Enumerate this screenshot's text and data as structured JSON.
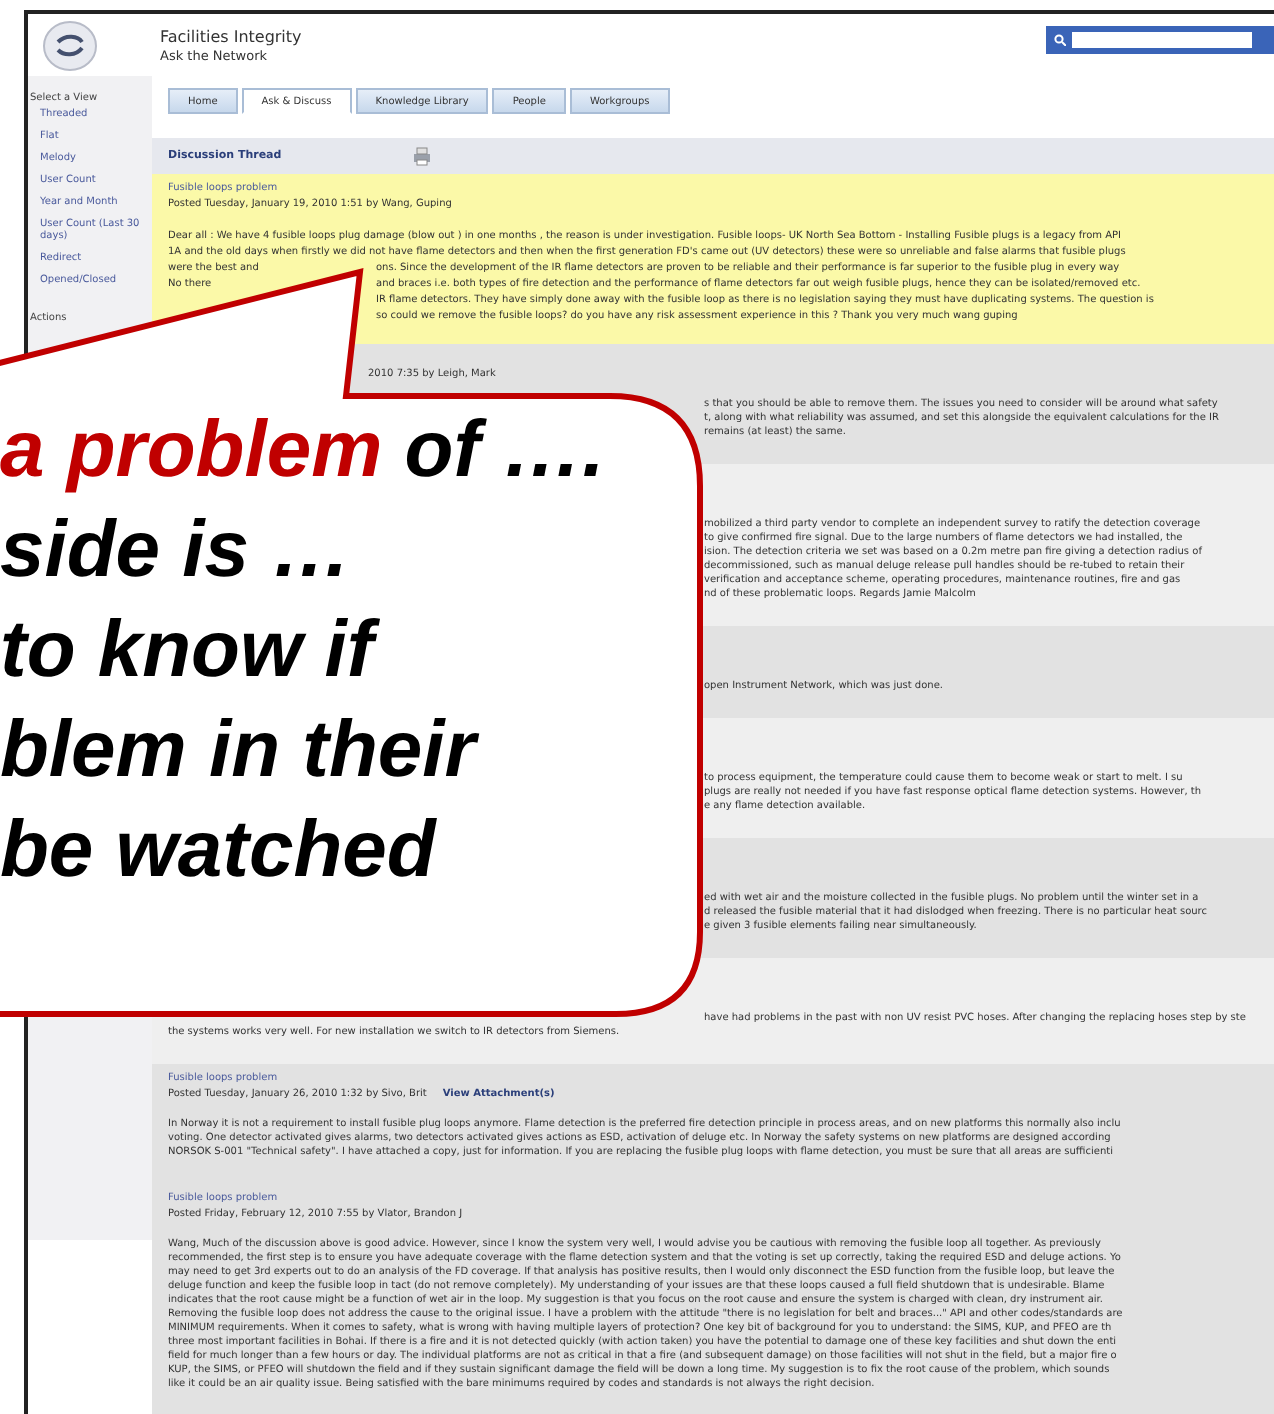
{
  "header": {
    "title": "Facilities Integrity",
    "subtitle": "Ask the Network"
  },
  "sidebar": {
    "heading": "Select a View",
    "items": [
      {
        "label": "Threaded"
      },
      {
        "label": "Flat"
      },
      {
        "label": "Melody"
      },
      {
        "label": "User Count"
      },
      {
        "label": "Year and Month"
      },
      {
        "label": "User Count (Last 30 days)"
      },
      {
        "label": "Redirect"
      },
      {
        "label": "Opened/Closed"
      }
    ],
    "actions": "Actions"
  },
  "tabs": [
    {
      "label": "Home",
      "selected": false
    },
    {
      "label": "Ask & Discuss",
      "selected": true
    },
    {
      "label": "Knowledge Library",
      "selected": false
    },
    {
      "label": "People",
      "selected": false
    },
    {
      "label": "Workgroups",
      "selected": false
    }
  ],
  "thread_title": "Discussion Thread",
  "posts": [
    {
      "kind": "highlight",
      "title": "Fusible loops problem",
      "posted": "Posted Tuesday, January 19, 2010 1:51 by Wang, Guping",
      "lines": [
        {
          "kind": "clear",
          "segments": [
            "Dear all : We have 4 fusible loops plug damage (blow out ) in one months , the reason is under investigation. Fusible loops- UK North Sea Bottom - Installing Fusible plugs is a legacy from API"
          ]
        },
        {
          "kind": "clear",
          "segments": [
            "1A and the old days when firstly we did not have flame detectors and then when the first generation FD's came out (UV detectors) these were so unreliable and false alarms that fusible plugs"
          ]
        },
        {
          "kind": "split",
          "segments": [
            "were the best and",
            "ons. Since the development of the IR flame detectors are proven to be reliable and their performance is far superior to the fusible plug in every way"
          ]
        },
        {
          "kind": "split",
          "segments": [
            "No there",
            "and braces i.e. both types of fire detection and the performance of flame detectors far out weigh fusible plugs, hence they can be isolated/removed etc."
          ]
        },
        {
          "kind": "tail",
          "segments": [
            "IR flame detectors. They have simply done away with the fusible loop as there is no legislation saying they must have duplicating systems. The question is"
          ]
        },
        {
          "kind": "tail",
          "segments": [
            "so could we remove the fusible loops? do you have any risk assessment experience in this ? Thank you very much wang guping"
          ]
        }
      ]
    },
    {
      "kind": "covered",
      "posted": "2010 7:35 by Leigh, Mark",
      "lines": [
        {
          "kind": "callout",
          "segments": [
            "s that you should be able to remove them. The issues you need to consider will be around what safety"
          ]
        },
        {
          "kind": "callout",
          "segments": [
            "t, along with what reliability was assumed, and set this alongside the equivalent calculations for the IR"
          ]
        },
        {
          "kind": "callout",
          "segments": [
            "remains (at least) the same."
          ]
        }
      ]
    },
    {
      "kind": "covered",
      "lines": [
        {
          "kind": "callout",
          "segments": [
            "mobilized a third party vendor to complete an independent survey to ratify the detection coverage"
          ]
        },
        {
          "kind": "callout",
          "segments": [
            "to give confirmed fire signal. Due to the large numbers of flame detectors we had installed, the"
          ]
        },
        {
          "kind": "callout",
          "segments": [
            "ision. The detection criteria we set was based on a 0.2m metre pan fire giving a detection radius of"
          ]
        },
        {
          "kind": "callout",
          "segments": [
            "decommissioned, such as manual deluge release pull handles should be re-tubed to retain their"
          ]
        },
        {
          "kind": "callout",
          "segments": [
            "verification and acceptance scheme, operating procedures, maintenance routines, fire and gas"
          ]
        },
        {
          "kind": "callout",
          "segments": [
            "nd of these problematic loops. Regards Jamie Malcolm"
          ]
        }
      ]
    },
    {
      "kind": "covered",
      "lines": [
        {
          "kind": "callout",
          "segments": [
            "open Instrument Network, which was just done."
          ]
        }
      ]
    },
    {
      "kind": "covered",
      "lines": [
        {
          "kind": "callout",
          "segments": [
            "to process equipment, the temperature could cause them to become weak or start to melt. I su"
          ]
        },
        {
          "kind": "callout",
          "segments": [
            "plugs are really not needed if you have fast response optical flame detection systems. However, th"
          ]
        },
        {
          "kind": "callout",
          "segments": [
            "e any flame detection available."
          ]
        }
      ]
    },
    {
      "kind": "covered",
      "lines": [
        {
          "kind": "callout",
          "segments": [
            "ed with wet air and the moisture collected in the fusible plugs. No problem until the winter set in a"
          ]
        },
        {
          "kind": "callout",
          "segments": [
            "d released the fusible material that it had dislodged when freezing. There is no particular heat sourc"
          ]
        },
        {
          "kind": "callout",
          "segments": [
            "e given 3 fusible elements failing near simultaneously."
          ]
        }
      ]
    },
    {
      "kind": "covered",
      "lines": [
        {
          "kind": "callout",
          "segments": [
            "have had problems in the past with non UV resist PVC hoses. After changing the replacing hoses step by ste"
          ]
        },
        {
          "kind": "clear",
          "segments": [
            "the systems works very well. For new installation we switch to IR detectors from Siemens."
          ]
        }
      ]
    },
    {
      "kind": "plain",
      "title": "Fusible loops problem",
      "posted": "Posted Tuesday, January 26, 2010 1:32 by Sivo, Brit",
      "attachment": "View Attachment(s)",
      "lines": [
        {
          "kind": "clear",
          "segments": [
            "In Norway it is not a requirement to install fusible plug loops anymore. Flame detection is the preferred fire detection principle in process areas, and on new platforms this normally also inclu"
          ]
        },
        {
          "kind": "clear",
          "segments": [
            "voting. One detector activated gives alarms, two detectors activated gives actions as ESD, activation of deluge etc. In Norway the safety systems on new platforms are designed according"
          ]
        },
        {
          "kind": "clear",
          "segments": [
            "NORSOK S-001 \"Technical safety\". I have attached a copy, just for information. If you are replacing the fusible plug loops with flame detection, you must be sure that all areas are sufficienti"
          ]
        }
      ]
    },
    {
      "kind": "shaded",
      "title": "Fusible loops problem",
      "posted": "Posted Friday, February 12, 2010 7:55 by Vlator, Brandon J",
      "lines": [
        {
          "kind": "clear",
          "segments": [
            "Wang, Much of the discussion above is good advice. However, since I know the system very well, I would advise you be cautious with removing the fusible loop all together. As previously"
          ]
        },
        {
          "kind": "clear",
          "segments": [
            "recommended, the first step is to ensure you have adequate coverage with the flame detection system and that the voting is set up correctly, taking the required ESD and deluge actions. Yo"
          ]
        },
        {
          "kind": "clear",
          "segments": [
            "may need to get 3rd experts out to do an analysis of the FD coverage. If that analysis has positive results, then I would only disconnect the ESD function from the fusible loop, but leave the"
          ]
        },
        {
          "kind": "clear",
          "segments": [
            "deluge function and keep the fusible loop in tact (do not remove completely). My understanding of your issues are that these loops caused a full field shutdown that is undesirable. Blame"
          ]
        },
        {
          "kind": "clear",
          "segments": [
            "indicates that the root cause might be a function of wet air in the loop. My suggestion is that you focus on the root cause and ensure the system is charged with clean, dry instrument air."
          ]
        },
        {
          "kind": "clear",
          "segments": [
            "Removing the fusible loop does not address the cause to the original issue. I have a problem with the attitude \"there is no legislation for belt and braces...\" API and other codes/standards are"
          ]
        },
        {
          "kind": "clear",
          "segments": [
            "MINIMUM requirements. When it comes to safety, what is wrong with having multiple layers of protection? One key bit of background for you to understand: the SIMS, KUP, and PFEO are th"
          ]
        },
        {
          "kind": "clear",
          "segments": [
            "three most important facilities in Bohai. If there is a fire and it is not detected quickly (with action taken) you have the potential to damage one of these key facilities and shut down the enti"
          ]
        },
        {
          "kind": "clear",
          "segments": [
            "field for much longer than a few hours or day. The individual platforms are not as critical in that a fire (and subsequent damage) on those facilities will not shut in the field, but a major fire o"
          ]
        },
        {
          "kind": "clear",
          "segments": [
            "KUP, the SIMS, or PFEO will shutdown the field and if they sustain significant damage the field will be down a long time. My suggestion is to fix the root cause of the problem, which sounds"
          ]
        },
        {
          "kind": "clear",
          "segments": [
            "like it could be an air quality issue. Being satisfied with the bare minimums required by codes and standards is not always the right decision."
          ]
        }
      ]
    }
  ],
  "callout": {
    "lines": [
      {
        "emphasis": "a problem",
        "text": " of …."
      },
      {
        "text": "side is …"
      },
      {
        "text": "to know if"
      },
      {
        "text": "blem in their"
      },
      {
        "text": "be watched"
      }
    ]
  }
}
